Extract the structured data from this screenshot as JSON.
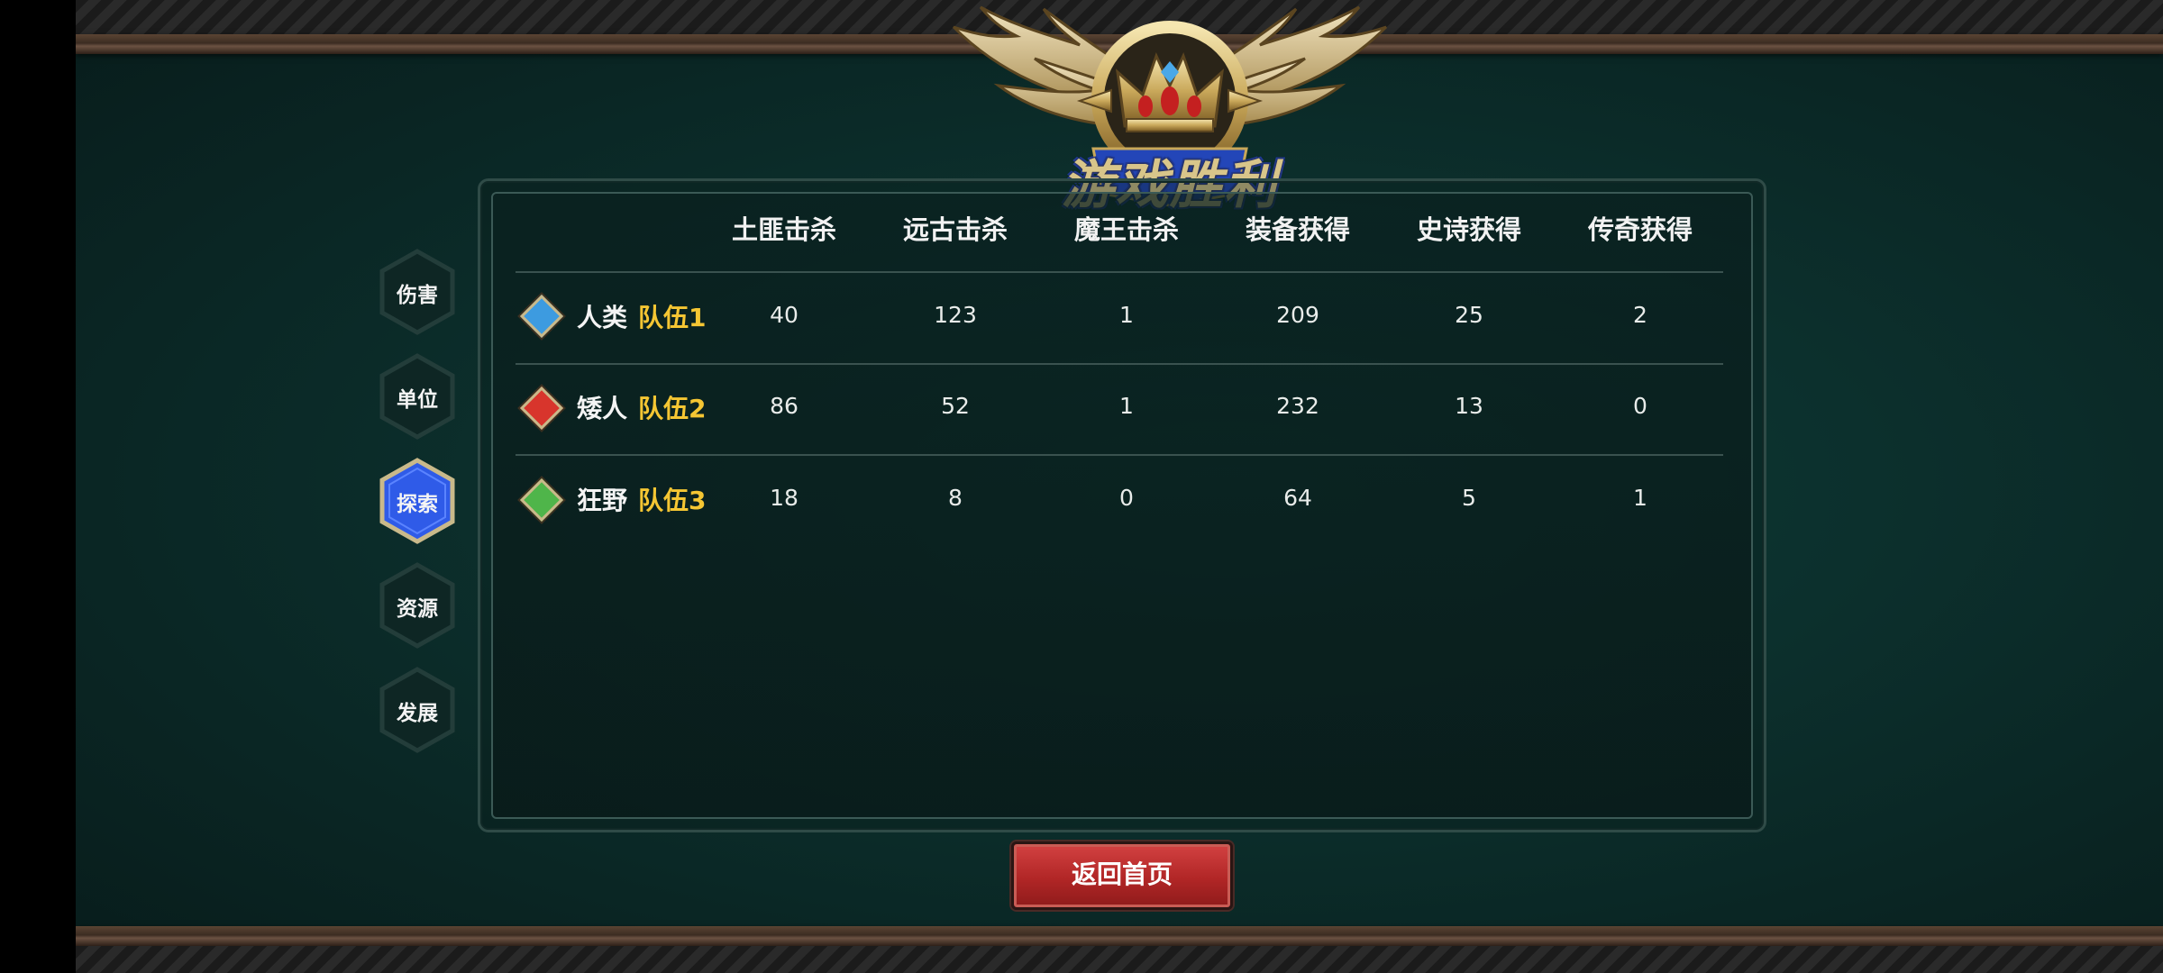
{
  "title": "游戏胜利",
  "tabs": [
    {
      "label": "伤害",
      "active": false
    },
    {
      "label": "单位",
      "active": false
    },
    {
      "label": "探索",
      "active": true
    },
    {
      "label": "资源",
      "active": false
    },
    {
      "label": "发展",
      "active": false
    }
  ],
  "table": {
    "headers": [
      "土匪击杀",
      "远古击杀",
      "魔王击杀",
      "装备获得",
      "史诗获得",
      "传奇获得"
    ],
    "rows": [
      {
        "race": "人类",
        "team": "队伍1",
        "gem_color": "#3d9be0",
        "values": [
          "40",
          "123",
          "1",
          "209",
          "25",
          "2"
        ]
      },
      {
        "race": "矮人",
        "team": "队伍2",
        "gem_color": "#d8352c",
        "values": [
          "86",
          "52",
          "1",
          "232",
          "13",
          "0"
        ]
      },
      {
        "race": "狂野",
        "team": "队伍3",
        "gem_color": "#4fb54a",
        "values": [
          "18",
          "8",
          "0",
          "64",
          "5",
          "1"
        ]
      }
    ]
  },
  "return_button": "返回首页",
  "colors": {
    "team_text": "#f5c633",
    "active_tab": "#2f5be8",
    "button": "#b12626"
  }
}
